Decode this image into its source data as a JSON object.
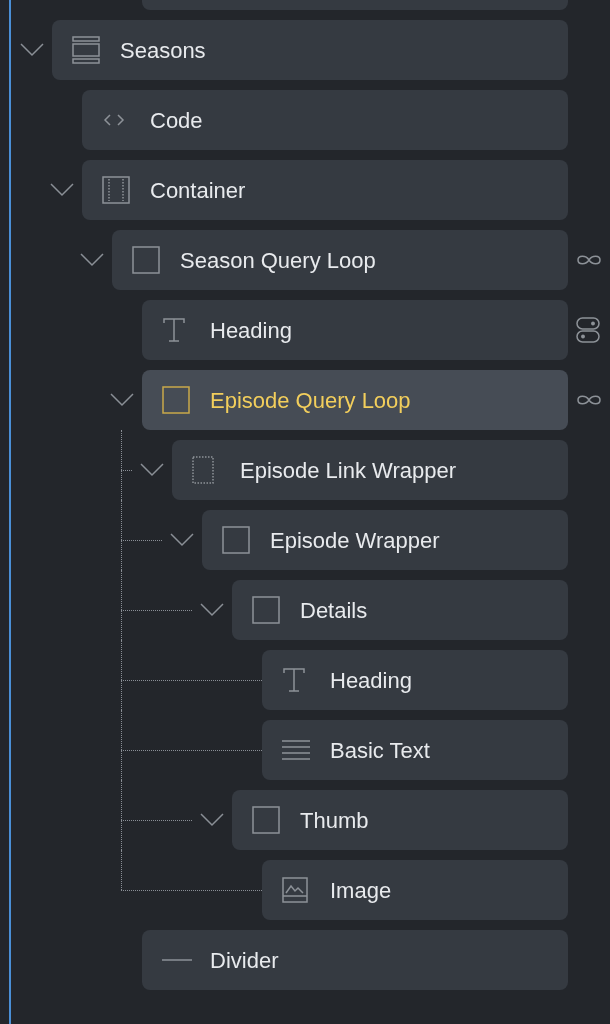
{
  "tree": [
    {
      "label": "Seasons",
      "kind": "section",
      "expanded": true,
      "selected": false,
      "children": [
        {
          "label": "Code",
          "kind": "code",
          "expanded": false,
          "selected": false
        },
        {
          "label": "Container",
          "kind": "container",
          "expanded": true,
          "selected": false,
          "children": [
            {
              "label": "Season Query Loop",
              "kind": "block",
              "badge": {
                "kind": "loop"
              },
              "expanded": true,
              "selected": false,
              "children": [
                {
                  "label": "Heading",
                  "kind": "heading",
                  "badge": {
                    "kind": "condition"
                  },
                  "expanded": false,
                  "selected": false
                },
                {
                  "label": "Episode Query Loop",
                  "kind": "block",
                  "badge": {
                    "kind": "loop"
                  },
                  "expanded": true,
                  "selected": true,
                  "children": [
                    {
                      "label": "Episode Link Wrapper",
                      "kind": "wrapper",
                      "expanded": true,
                      "selected": false,
                      "children": [
                        {
                          "label": "Episode Wrapper",
                          "kind": "block",
                          "expanded": true,
                          "selected": false,
                          "children": [
                            {
                              "label": "Details",
                              "kind": "block",
                              "expanded": true,
                              "selected": false,
                              "children": [
                                {
                                  "label": "Heading",
                                  "kind": "heading",
                                  "expanded": false,
                                  "selected": false
                                },
                                {
                                  "label": "Basic Text",
                                  "kind": "text",
                                  "expanded": false,
                                  "selected": false
                                }
                              ]
                            },
                            {
                              "label": "Thumb",
                              "kind": "block",
                              "expanded": true,
                              "selected": false,
                              "children": [
                                {
                                  "label": "Image",
                                  "kind": "image",
                                  "expanded": false,
                                  "selected": false
                                }
                              ]
                            }
                          ]
                        }
                      ]
                    }
                  ]
                },
                {
                  "label": "Divider",
                  "kind": "divider",
                  "expanded": false,
                  "selected": false
                }
              ]
            }
          ]
        }
      ]
    }
  ]
}
